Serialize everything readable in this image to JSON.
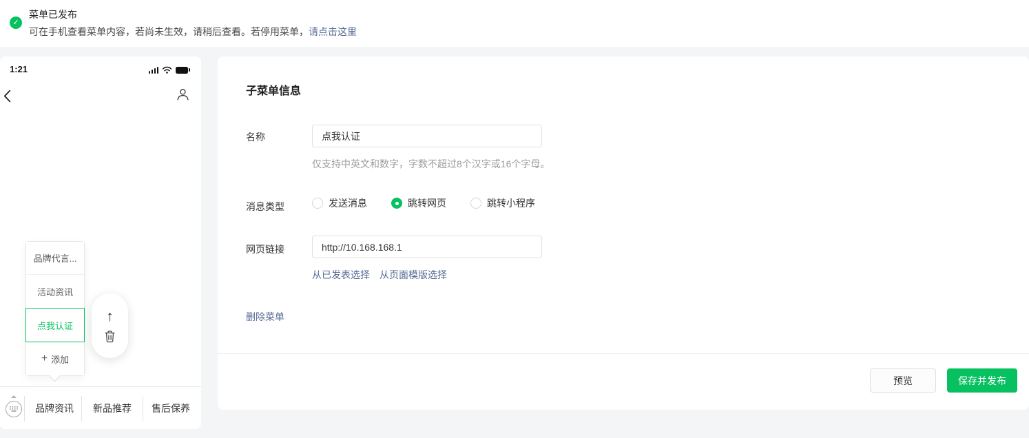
{
  "banner": {
    "title": "菜单已发布",
    "subtitle": "可在手机查看菜单内容，若尚未生效，请稍后查看。若停用菜单，",
    "link": "请点击这里"
  },
  "colors": {
    "brand_green": "#07C160",
    "link_blue": "#576b95"
  },
  "icons": {
    "check": "✓",
    "up_arrow": "↑",
    "plus": "+"
  },
  "phone": {
    "time": "1:21",
    "submenu": {
      "items": [
        {
          "label": "品牌代言...",
          "active": false
        },
        {
          "label": "活动资讯",
          "active": false
        },
        {
          "label": "点我认证",
          "active": true
        },
        {
          "label": "添加",
          "active": false,
          "icon": "plus-icon"
        }
      ]
    },
    "menu_bar": {
      "items": [
        "品牌资讯",
        "新品推荐",
        "售后保养"
      ]
    }
  },
  "form": {
    "title": "子菜单信息",
    "name_field": {
      "label": "名称",
      "value": "点我认证",
      "hint": "仅支持中英文和数字，字数不超过8个汉字或16个字母。"
    },
    "message_type": {
      "label": "消息类型",
      "options": [
        {
          "label": "发送消息",
          "selected": false
        },
        {
          "label": "跳转网页",
          "selected": true
        },
        {
          "label": "跳转小程序",
          "selected": false
        }
      ]
    },
    "url_field": {
      "label": "网页链接",
      "value": "http://10.168.168.1",
      "links": [
        "从已发表选择",
        "从页面模版选择"
      ]
    },
    "delete_link": "删除菜单",
    "footer": {
      "preview_label": "预览",
      "save_label": "保存并发布"
    }
  }
}
